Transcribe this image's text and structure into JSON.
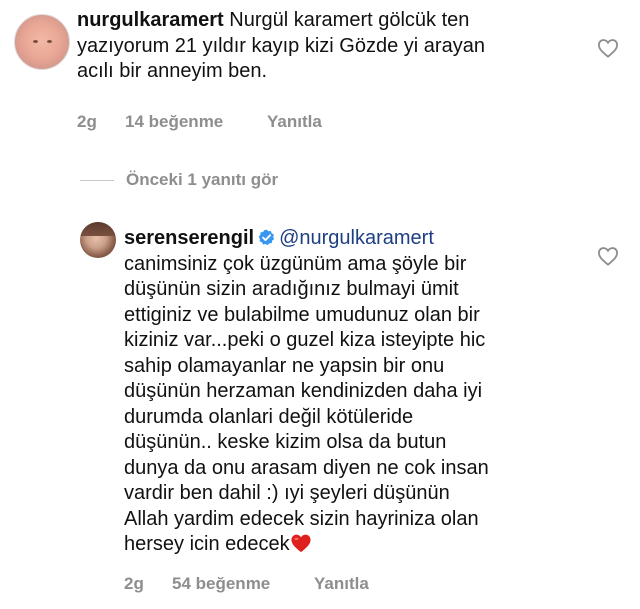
{
  "comments": [
    {
      "username": "nurgulkaramert",
      "text": " Nurgül karamert  gölcük ten\nyazıyorum 21 yıldır kayıp kizi Gözde yi arayan\nacılı bir anneyim ben.",
      "time": "2g",
      "likes": "14 beğenme",
      "reply_label": "Yanıtla",
      "avatar_icon": "profile-photo",
      "like_icon": "heart-outline-icon"
    },
    {
      "username": "serenserengil",
      "verified_icon": "verified-badge-icon",
      "mention": "@nurgulkaramert",
      "text": "canimsiniz çok  üzgünüm  ama şöyle  bir\ndüşünün  sizin aradığınız  bulmayi ümit\nettiginiz ve bulabilme umudunuz olan bir\nkiziniz var...peki o guzel kiza isteyipte hic\nsahip olamayanlar ne yapsin bir onu\ndüşünün herzaman kendinizden daha iyi\ndurumda olanlari değil  kötüleride\ndüşünün.. keske kizim olsa da butun\ndunya da onu arasam diyen ne cok insan\nvardir ben dahil :) ıyi  şeyleri  düşünün\nAllah  yardim edecek  sizin hayriniza olan\nhersey icin edecek",
      "emoji": "red-heart-emoji",
      "time": "2g",
      "likes": "54 beğenme",
      "reply_label": "Yanıtla",
      "avatar_icon": "profile-photo",
      "like_icon": "heart-outline-icon"
    }
  ],
  "view_replies_label": "Önceki 1 yanıtı gör",
  "colors": {
    "text": "#111111",
    "meta": "#8e8e8e",
    "mention": "#1d3f82",
    "verified": "#3897f0",
    "heart_emoji": "#e0201d"
  }
}
